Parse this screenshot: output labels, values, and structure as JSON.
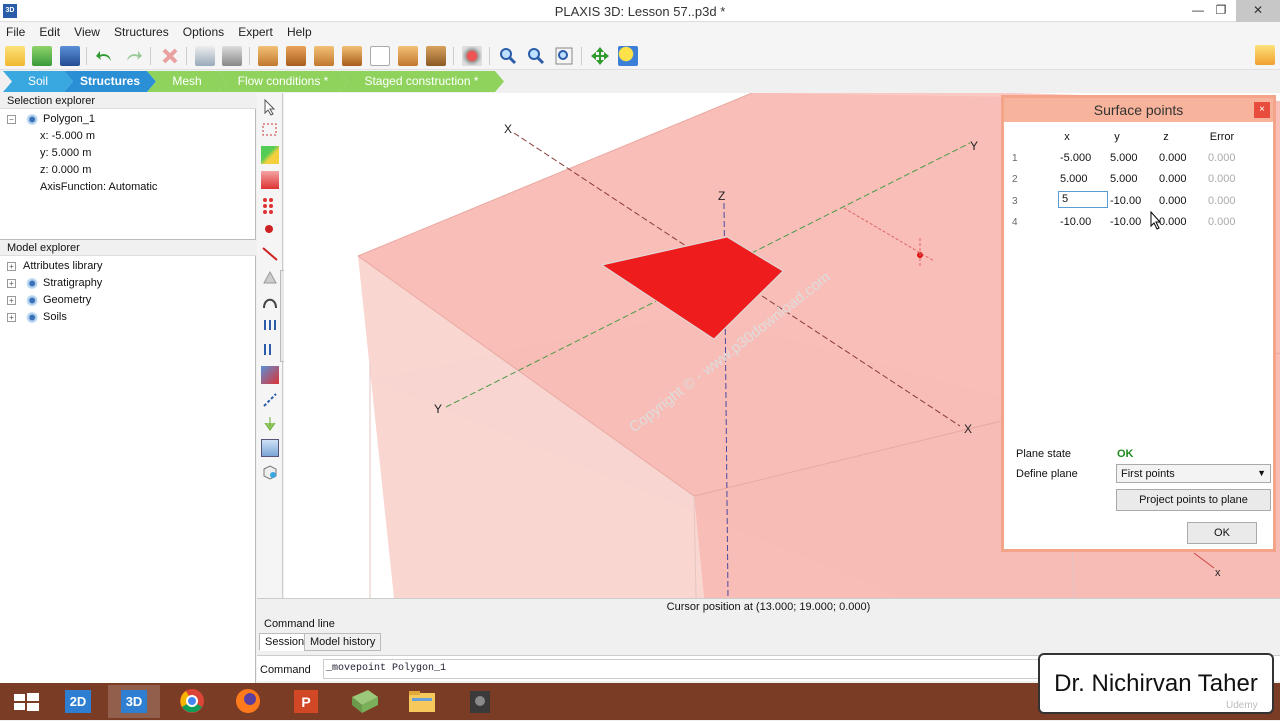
{
  "window": {
    "app_icon": "3D",
    "title": "PLAXIS 3D: Lesson 57..p3d *"
  },
  "menu": [
    "File",
    "Edit",
    "View",
    "Structures",
    "Options",
    "Expert",
    "Help"
  ],
  "modes": [
    {
      "label": "Soil",
      "color": "#3aa8e0"
    },
    {
      "label": "Structures",
      "color": "#2b8fd6"
    },
    {
      "label": "Mesh",
      "color": "#8fd35d"
    },
    {
      "label": "Flow conditions *",
      "color": "#8fd35d"
    },
    {
      "label": "Staged construction *",
      "color": "#8fd35d"
    }
  ],
  "selection_explorer": {
    "title": "Selection explorer",
    "root": "Polygon_1",
    "props": [
      "x: -5.000 m",
      "y: 5.000 m",
      "z: 0.000 m",
      "AxisFunction: Automatic"
    ]
  },
  "model_explorer": {
    "title": "Model explorer",
    "items": [
      "Attributes library",
      "Stratigraphy",
      "Geometry",
      "Soils"
    ]
  },
  "viewport": {
    "axis_labels": {
      "x_top": "X",
      "x_bottom": "X",
      "y_left": "Y",
      "y_right": "Y",
      "z": "Z",
      "x_small": "x"
    },
    "watermark": "Copyright © - www.p30download.com"
  },
  "status": {
    "cursor_text": "Cursor position at (13.000; 19.000; 0.000)"
  },
  "command": {
    "title": "Command line",
    "tabs": [
      "Session",
      "Model history"
    ],
    "label": "Command",
    "input_value": "_movepoint Polygon_1"
  },
  "dialog": {
    "title": "Surface points",
    "close": "×",
    "columns": [
      "x",
      "y",
      "z",
      "Error"
    ],
    "rows": [
      {
        "n": "1",
        "x": "-5.000",
        "y": "5.000",
        "z": "0.000",
        "err": "0.000"
      },
      {
        "n": "2",
        "x": "5.000",
        "y": "5.000",
        "z": "0.000",
        "err": "0.000"
      },
      {
        "n": "3",
        "x": "5",
        "y": "-10.00",
        "z": "0.000",
        "err": "0.000"
      },
      {
        "n": "4",
        "x": "-10.00",
        "y": "-10.00",
        "z": "0.000",
        "err": "0.000"
      }
    ],
    "plane_state_label": "Plane state",
    "plane_state_value": "OK",
    "define_plane_label": "Define plane",
    "define_plane_value": "First points",
    "project_button": "Project points to plane",
    "ok_button": "OK"
  },
  "taskbar": {
    "items": [
      "windows-start",
      "plaxis-2d",
      "plaxis-3d",
      "chrome",
      "firefox",
      "powerpoint",
      "app-green",
      "file-explorer",
      "camera-app"
    ],
    "active": "plaxis-3d"
  },
  "overlay": {
    "name": "Dr. Nichirvan Taher",
    "brand": "Udemy"
  }
}
